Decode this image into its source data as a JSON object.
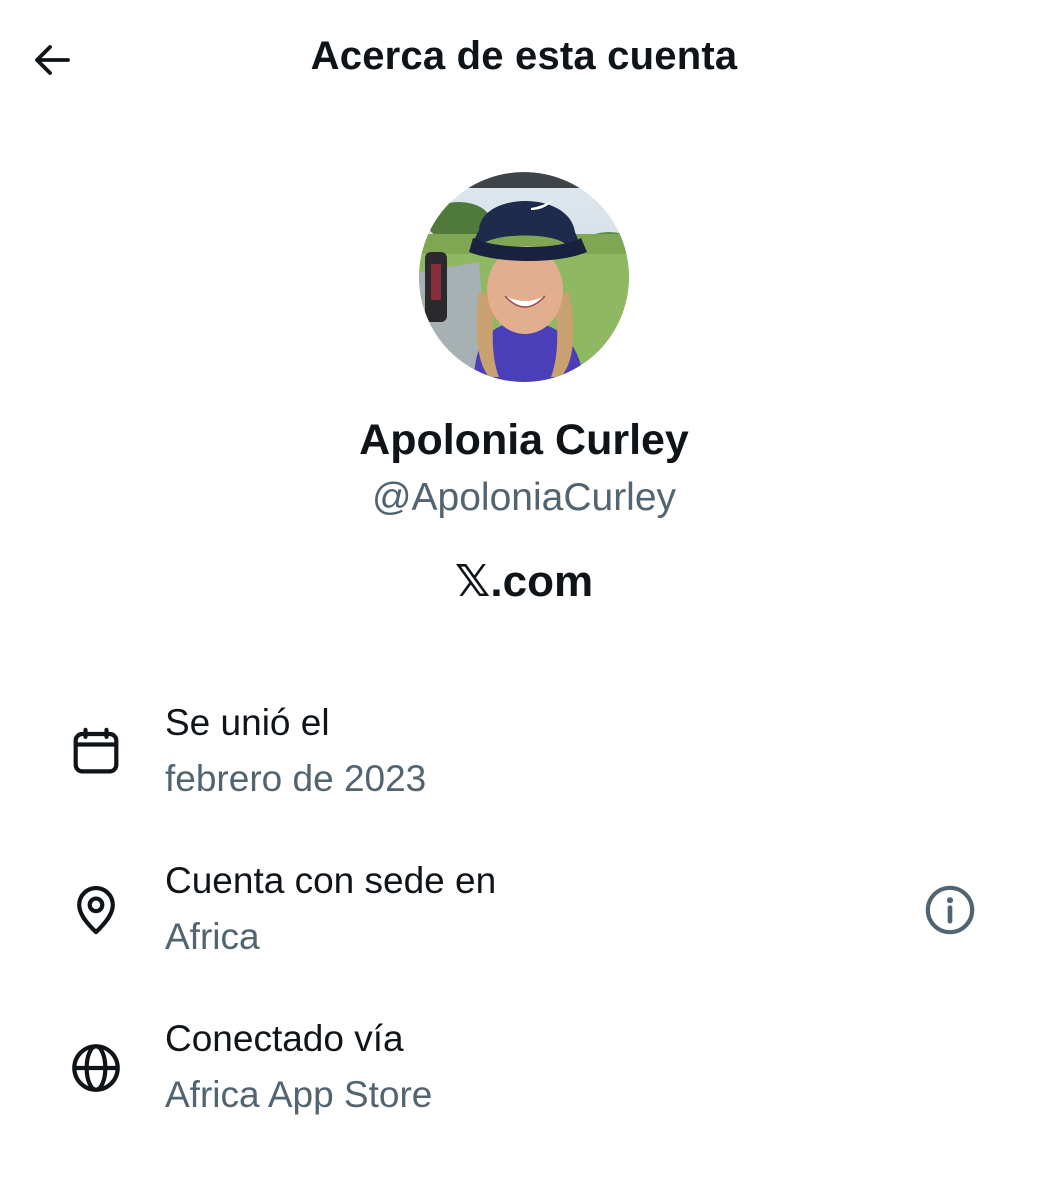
{
  "header": {
    "back_icon": "arrow-left-icon",
    "title": "Acerca de esta cuenta"
  },
  "profile": {
    "display_name": "Apolonia Curley",
    "handle": "@ApoloniaCurley",
    "brand_x": "𝕏",
    "brand_suffix": ".com"
  },
  "details": [
    {
      "icon": "calendar-icon",
      "label": "Se unió el",
      "value": "febrero de 2023"
    },
    {
      "icon": "location-pin-icon",
      "label": "Cuenta con sede en",
      "value": "Africa",
      "trailing_icon": "info-icon"
    },
    {
      "icon": "globe-icon",
      "label": "Conectado vía",
      "value": "Africa App Store"
    }
  ],
  "colors": {
    "primary_text": "#0f1419",
    "secondary_text": "#536471",
    "background": "#ffffff"
  }
}
